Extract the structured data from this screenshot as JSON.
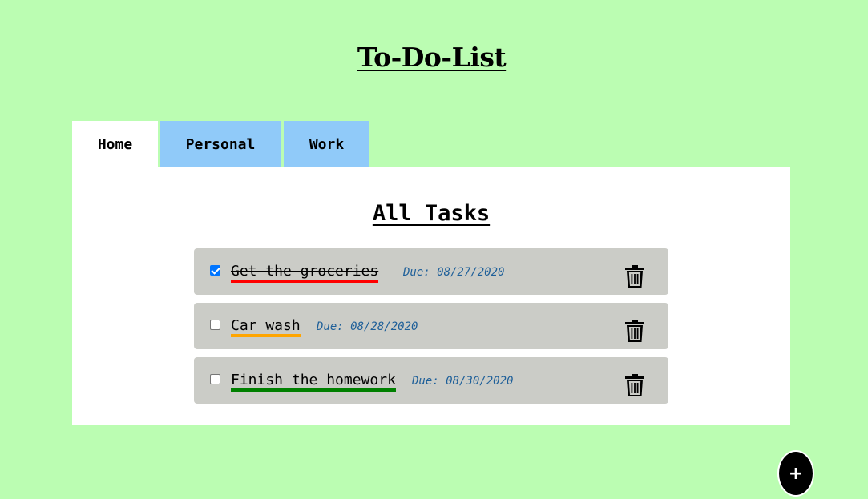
{
  "header": {
    "title": "To-Do-List"
  },
  "tabs": [
    {
      "label": "Home",
      "active": true
    },
    {
      "label": "Personal",
      "active": false
    },
    {
      "label": "Work",
      "active": false
    }
  ],
  "panel": {
    "title": "All Tasks"
  },
  "tasks": [
    {
      "name": "Get the groceries",
      "due": "Due: 08/27/2020",
      "completed": true,
      "priority_color": "#ff0000"
    },
    {
      "name": "Car wash",
      "due": "Due: 08/28/2020",
      "completed": false,
      "priority_color": "#ffa500"
    },
    {
      "name": "Finish the homework",
      "due": "Due: 08/30/2020",
      "completed": false,
      "priority_color": "#008000"
    }
  ],
  "fab": {
    "label": "+"
  },
  "icons": {
    "delete": "trash-icon",
    "add": "plus-icon"
  },
  "colors": {
    "background": "#bbfdb2",
    "tab_inactive": "#90caf9",
    "task_card": "#cbccc7",
    "due_text": "#1e5f99"
  }
}
